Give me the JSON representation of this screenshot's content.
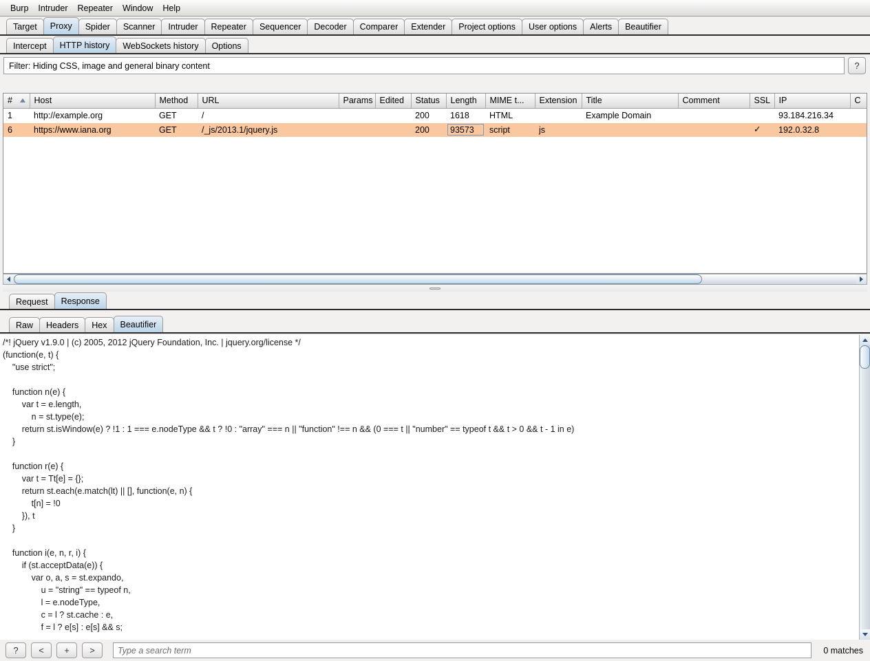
{
  "menubar": {
    "items": [
      "Burp",
      "Intruder",
      "Repeater",
      "Window",
      "Help"
    ]
  },
  "main_tabs": {
    "selected": "Proxy",
    "items": [
      "Target",
      "Proxy",
      "Spider",
      "Scanner",
      "Intruder",
      "Repeater",
      "Sequencer",
      "Decoder",
      "Comparer",
      "Extender",
      "Project options",
      "User options",
      "Alerts",
      "Beautifier"
    ]
  },
  "proxy_tabs": {
    "selected": "HTTP history",
    "items": [
      "Intercept",
      "HTTP history",
      "WebSockets history",
      "Options"
    ]
  },
  "filter": {
    "text": "Filter: Hiding CSS, image and general binary content",
    "help_label": "?"
  },
  "table": {
    "columns": [
      "#",
      "Host",
      "Method",
      "URL",
      "Params",
      "Edited",
      "Status",
      "Length",
      "MIME t...",
      "Extension",
      "Title",
      "Comment",
      "SSL",
      "IP",
      "C"
    ],
    "sort_column": "#",
    "sort_direction": "ascending",
    "rows": [
      {
        "num": "1",
        "host": "http://example.org",
        "method": "GET",
        "url": "/",
        "params": "",
        "edited": "",
        "status": "200",
        "length": "1618",
        "mime": "HTML",
        "extension": "",
        "title": "Example Domain",
        "comment": "",
        "ssl": "",
        "ip": "93.184.216.34",
        "cookies": "",
        "highlighted": false,
        "selected_cell": ""
      },
      {
        "num": "6",
        "host": "https://www.iana.org",
        "method": "GET",
        "url": "/_js/2013.1/jquery.js",
        "params": "",
        "edited": "",
        "status": "200",
        "length": "93573",
        "mime": "script",
        "extension": "js",
        "title": "",
        "comment": "",
        "ssl": "✓",
        "ip": "192.0.32.8",
        "cookies": "",
        "highlighted": true,
        "selected_cell": "length"
      }
    ]
  },
  "message_tabs": {
    "selected": "Response",
    "items": [
      "Request",
      "Response"
    ]
  },
  "view_tabs": {
    "selected": "Beautifier",
    "items": [
      "Raw",
      "Headers",
      "Hex",
      "Beautifier"
    ]
  },
  "code": {
    "body": "/*! jQuery v1.9.0 | (c) 2005, 2012 jQuery Foundation, Inc. | jquery.org/license */\n(function(e, t) {\n    \"use strict\";\n\n    function n(e) {\n        var t = e.length,\n            n = st.type(e);\n        return st.isWindow(e) ? !1 : 1 === e.nodeType && t ? !0 : \"array\" === n || \"function\" !== n && (0 === t || \"number\" == typeof t && t > 0 && t - 1 in e)\n    }\n\n    function r(e) {\n        var t = Tt[e] = {};\n        return st.each(e.match(lt) || [], function(e, n) {\n            t[n] = !0\n        }), t\n    }\n\n    function i(e, n, r, i) {\n        if (st.acceptData(e)) {\n            var o, a, s = st.expando,\n                u = \"string\" == typeof n,\n                l = e.nodeType,\n                c = l ? st.cache : e,\n                f = l ? e[s] : e[s] && s;"
  },
  "search": {
    "help_label": "?",
    "prev_label": "<",
    "add_label": "+",
    "next_label": ">",
    "placeholder": "Type a search term",
    "value": "",
    "matches": "0 matches"
  }
}
